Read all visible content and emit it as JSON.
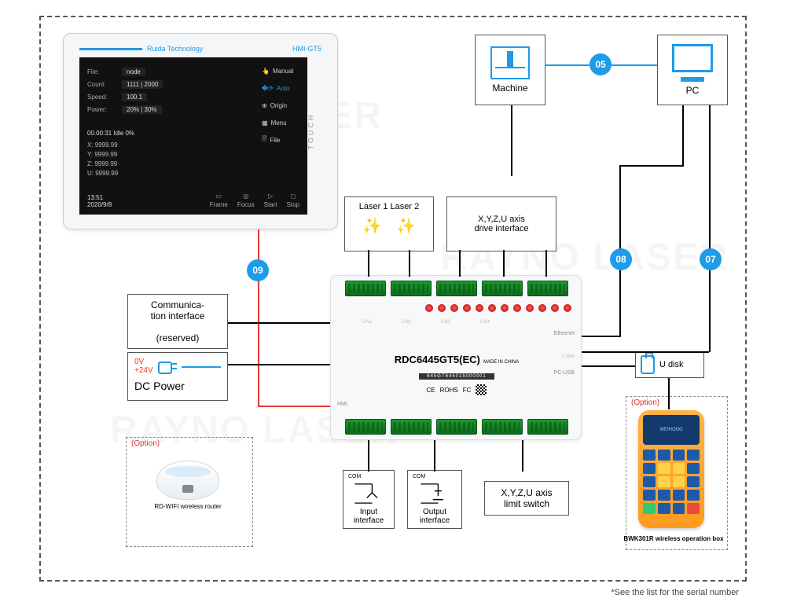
{
  "watermark": "RAYNO LASER",
  "bubbles": {
    "b05": "05",
    "b07": "07",
    "b08": "08",
    "b09": "09"
  },
  "nodes": {
    "machine": "Machine",
    "pc": "PC",
    "laser_box": "Laser 1  Laser 2",
    "drive_if": "X,Y,Z,U axis\ndrive interface",
    "comm_if": "Communica-\ntion interface\n\n(reserved)",
    "dc_power": "DC Power",
    "v0": "0V",
    "v24": "+24V",
    "udisk": "U disk",
    "input_if": "Input\ninterface",
    "output_if": "Output\ninterface",
    "limit_sw": "X,Y,Z,U axis\nlimit switch",
    "io_com": "COM"
  },
  "options": {
    "label": "(Option)",
    "router_caption": "RD-WIFI wireless router",
    "remote_caption": "BWK301R wireless operation box",
    "remote_screen": "WEIHONG"
  },
  "hmi": {
    "brand": "Ruida Technology",
    "model": "HMI-GT5",
    "touch": "TOUCH",
    "rows": {
      "file_lbl": "File:",
      "file_val": "node",
      "count_lbl": "Count:",
      "count_val": "1111 | 2000",
      "speed_lbl": "Speed:",
      "speed_val": "100.1",
      "power_lbl": "Power:",
      "power_val": "20% | 30%"
    },
    "side": {
      "manual": "Manual",
      "auto": "Auto",
      "origin": "Origin",
      "menu": "Menu",
      "file": "File"
    },
    "status": "00.00:31  Idle  0%",
    "coords": {
      "x": "X: 9999.99",
      "y": "Y: 9999.99",
      "z": "Z: 9999.99",
      "u": "U: 9999.99"
    },
    "time": "13:51",
    "date": "2020/9/8",
    "btns": {
      "frame": "Frame",
      "focus": "Focus",
      "start": "Start",
      "stop": "Stop"
    }
  },
  "controller": {
    "model": "RDC6445GT5(EC)",
    "made": "MADE IN CHINA",
    "sn": "645GT645015000001",
    "cert_ce": "CE",
    "cert_rohs": "ROHS",
    "cert_fc": "FC",
    "eth": "Ethernet",
    "pcusb": "PC-USB",
    "hmi": "HMI",
    "udisk_port": "U disk"
  },
  "footnote": "*See the list for the serial number"
}
